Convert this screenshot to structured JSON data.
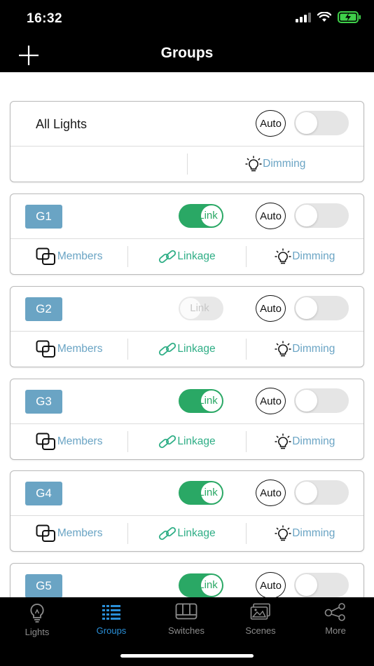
{
  "status_bar": {
    "time": "16:32"
  },
  "nav": {
    "title": "Groups"
  },
  "all_lights": {
    "title": "All Lights",
    "auto_label": "Auto",
    "dimming_label": "Dimming"
  },
  "groups": [
    {
      "name": "G1",
      "link_label": "Link",
      "link_on": true,
      "auto_label": "Auto",
      "members_label": "Members",
      "linkage_label": "Linkage",
      "dimming_label": "Dimming"
    },
    {
      "name": "G2",
      "link_label": "Link",
      "link_on": false,
      "auto_label": "Auto",
      "members_label": "Members",
      "linkage_label": "Linkage",
      "dimming_label": "Dimming"
    },
    {
      "name": "G3",
      "link_label": "Link",
      "link_on": true,
      "auto_label": "Auto",
      "members_label": "Members",
      "linkage_label": "Linkage",
      "dimming_label": "Dimming"
    },
    {
      "name": "G4",
      "link_label": "Link",
      "link_on": true,
      "auto_label": "Auto",
      "members_label": "Members",
      "linkage_label": "Linkage",
      "dimming_label": "Dimming"
    },
    {
      "name": "G5",
      "link_label": "Link",
      "link_on": true,
      "auto_label": "Auto"
    }
  ],
  "tabs": [
    {
      "label": "Lights",
      "icon": "bulb-icon",
      "active": false
    },
    {
      "label": "Groups",
      "icon": "groups-list-icon",
      "active": true
    },
    {
      "label": "Switches",
      "icon": "switch-panel-icon",
      "active": false
    },
    {
      "label": "Scenes",
      "icon": "scenes-icon",
      "active": false
    },
    {
      "label": "More",
      "icon": "share-nodes-icon",
      "active": false
    }
  ],
  "colors": {
    "accent_blue": "#6aa4c4",
    "link_green": "#2aa865",
    "linkage_green": "#2fae86",
    "tab_active": "#2a8fd8"
  }
}
